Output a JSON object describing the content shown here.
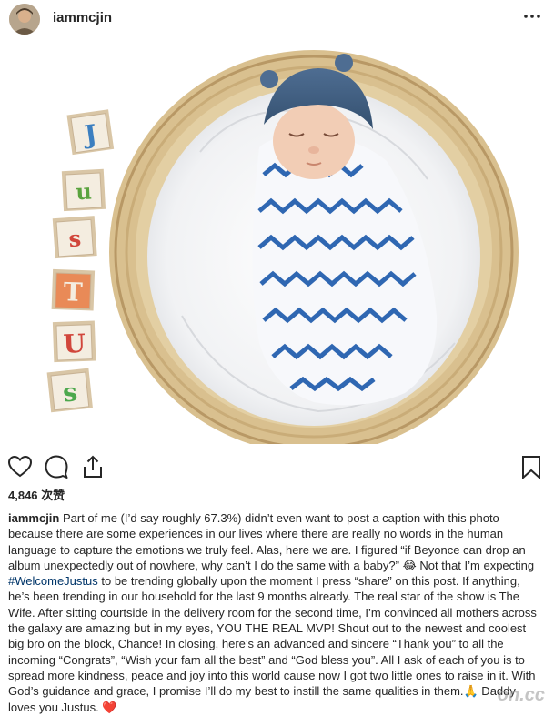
{
  "post": {
    "username": "iammcjin",
    "more_icon": "more-horizontal-icon",
    "likes": "4,846 次赞",
    "caption": {
      "username": "iammcjin",
      "part1": " Part of me (I’d say roughly 67.3%) didn’t even want to post a caption with this photo because there are some experiences in our lives where there are really no words in the human language to capture the emotions we truly feel. Alas, here we are. I figured “if Beyonce can drop an album unexpectedly out of nowhere, why can’t I do the same with a baby?” 😂 Not that I’m expecting ",
      "hashtag": "#WelcomeJustus",
      "part2": " to be trending globally upon the moment I press “share” on this post. If anything, he’s been trending in our household for the last 9 months already. The real star of the show is The Wife. After sitting courtside in the delivery room for the second time, I’m convinced all mothers across the galaxy are amazing but in my eyes, YOU THE REAL MVP! Shout out to the newest and coolest big bro on the block, Chance! In closing, here’s an advanced and sincere “Thank you” to all the incoming “Congrats”, “Wish your fam all the best” and “God bless you”. All I ask of each of you is to spread more kindness, peace and joy into this world cause now I got two little ones to raise in it. With God’s guidance and grace, I promise I’ll do my best to instill the same qualities in them.🙏 Daddy loves you Justus. ❤️"
    },
    "blocks": [
      "J",
      "u",
      "s",
      "T",
      "U",
      "s"
    ],
    "watermark": "on.cc"
  }
}
